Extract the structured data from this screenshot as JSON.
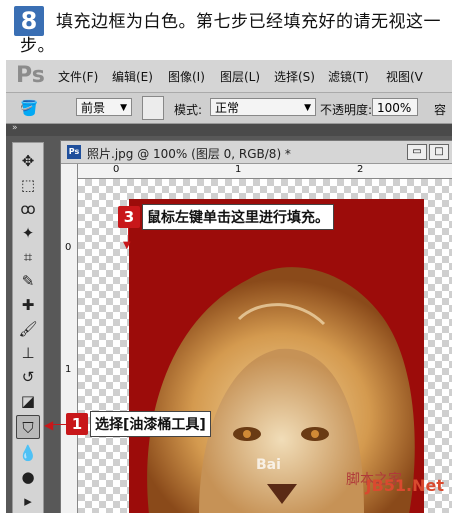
{
  "instruction": {
    "step_number": "8",
    "text": "填充边框为白色。第七步已经填充好的请无视这一步。"
  },
  "menubar": {
    "logo": "Ps",
    "items": [
      "文件(F)",
      "编辑(E)",
      "图像(I)",
      "图层(L)",
      "选择(S)",
      "滤镜(T)",
      "视图(V"
    ]
  },
  "options": {
    "fill_source": "前景",
    "mode_label": "模式:",
    "mode_value": "正常",
    "opacity_label": "不透明度:",
    "opacity_value": "100%",
    "tolerance_label": "容"
  },
  "document": {
    "icon": "Ps",
    "title": "照片.jpg @ 100% (图层 0, RGB/8) *",
    "ruler_h": [
      "0",
      "1",
      "2"
    ],
    "ruler_v": [
      "0",
      "1"
    ]
  },
  "callouts": {
    "tool": {
      "number": "1",
      "text": "选择[油漆桶工具]"
    },
    "canvas": {
      "number": "3",
      "text": "鼠标左键单击这里进行填充。"
    }
  },
  "watermarks": {
    "site_cn": "脚本之家",
    "site_en": "JB51.Net",
    "baidu": "Bai"
  },
  "colors": {
    "photo_background": "#9c0c0a",
    "callout_red": "#c8171a",
    "step_badge_blue": "#3a6fb4"
  },
  "icons": {
    "tools": [
      "move-icon",
      "marquee-icon",
      "lasso-icon",
      "magic-wand-icon",
      "crop-icon",
      "eyedropper-icon",
      "healing-brush-icon",
      "brush-icon",
      "stamp-icon",
      "history-brush-icon",
      "eraser-icon",
      "paint-bucket-icon",
      "blur-icon",
      "dodge-icon",
      "path-select-icon"
    ]
  }
}
